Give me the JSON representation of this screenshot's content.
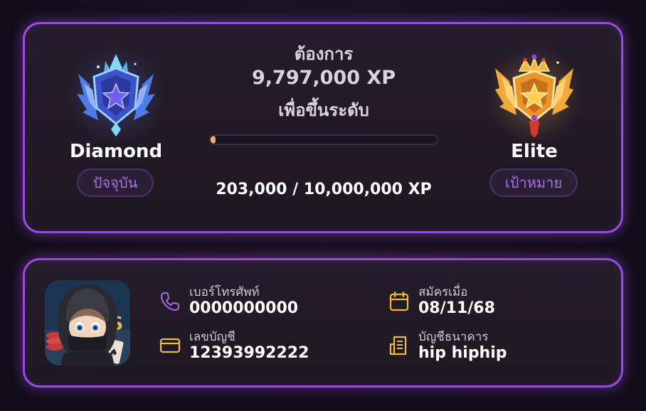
{
  "rank": {
    "current": {
      "name": "Diamond",
      "tag": "ปัจจุบัน",
      "icon": "diamond-rank-badge-icon"
    },
    "target": {
      "name": "Elite",
      "tag": "เป้าหมาย",
      "icon": "elite-rank-badge-icon"
    },
    "need_label": "ต้องการ",
    "need_xp": "9,797,000 XP",
    "need_suffix": "เพื่อขึ้นระดับ",
    "progress_fraction": 0.0203,
    "progress_text": "203,000 / 10,000,000 XP"
  },
  "profile": {
    "avatar": "ninja-avatar-image",
    "phone": {
      "label": "เบอร์โทรศัพท์",
      "value": "0000000000",
      "icon": "phone-icon"
    },
    "account_no": {
      "label": "เลขบัญชี",
      "value": "12393992222",
      "icon": "card-icon"
    },
    "registered": {
      "label": "สมัครเมื่อ",
      "value": "08/11/68",
      "icon": "calendar-icon"
    },
    "bank": {
      "label": "บัญชีธนาคาร",
      "value": "hip hiphip",
      "icon": "bank-receipt-icon"
    }
  },
  "colors": {
    "accent_purple": "#9a4be0",
    "icon_purple": "#a463e6",
    "icon_gold": "#f2b93f",
    "progress": "#f0b872"
  }
}
